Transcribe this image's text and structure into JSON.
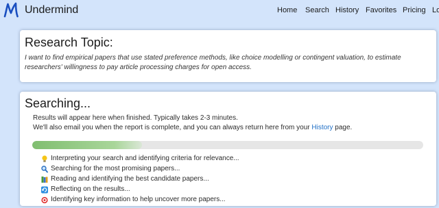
{
  "app": {
    "name": "Undermind"
  },
  "nav": {
    "items": [
      {
        "label": "Home"
      },
      {
        "label": "Search"
      },
      {
        "label": "History"
      },
      {
        "label": "Favorites"
      },
      {
        "label": "Pricing"
      },
      {
        "label": "Lo"
      }
    ]
  },
  "topic_card": {
    "title": "Research Topic:",
    "text": "I want to find empirical papers that use stated preference methods, like choice modelling or contingent valuation, to estimate researchers' willingness to pay article processing charges for open access."
  },
  "search_card": {
    "title": "Searching...",
    "line1": "Results will appear here when finished. Typically takes 2-3 minutes.",
    "line2_prefix": "We'll also email you when the report is complete, and you can always return here from your",
    "history_link": "History",
    "line2_suffix": "page.",
    "progress_fraction": 0.28,
    "steps": [
      {
        "icon": "lightbulb-icon",
        "label": "Interpreting your search and identifying criteria for relevance..."
      },
      {
        "icon": "magnifier-icon",
        "label": "Searching for the most promising papers..."
      },
      {
        "icon": "books-icon",
        "label": "Reading and identifying the best candidate papers..."
      },
      {
        "icon": "refresh-icon",
        "label": "Reflecting on the results..."
      },
      {
        "icon": "target-icon",
        "label": "Identifying key information to help uncover more papers..."
      }
    ]
  },
  "colors": {
    "background": "#d3e4fb",
    "brand_blue": "#1a4fc0",
    "link": "#1f6fc6",
    "progress_fill": "#8cc57c"
  }
}
